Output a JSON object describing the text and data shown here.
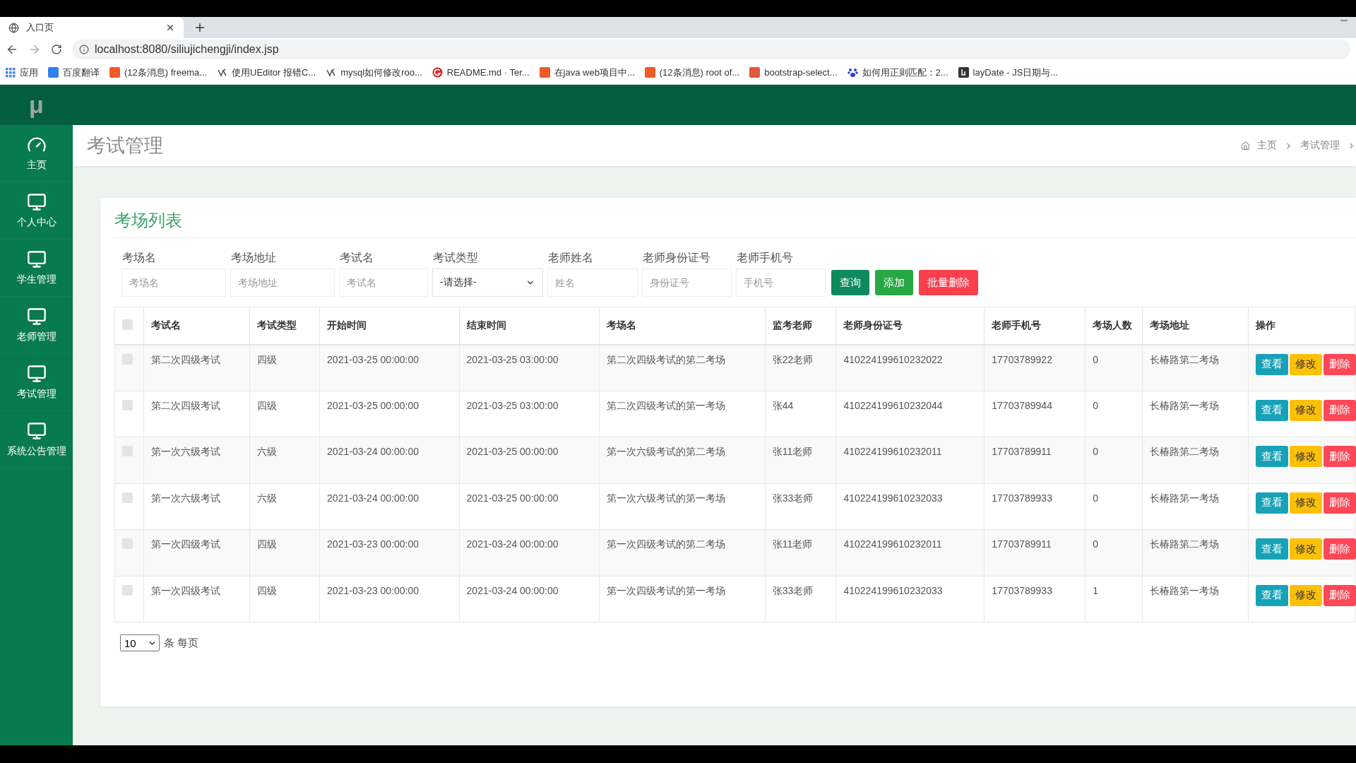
{
  "browser": {
    "tab_title": "入口页",
    "url": "localhost:8080/siliujichengji/index.jsp",
    "bookmarks": [
      {
        "label": "应用"
      },
      {
        "label": "百度翻译"
      },
      {
        "label": "(12条消息) freema..."
      },
      {
        "label": "使用UEditor 报错C..."
      },
      {
        "label": "mysql如何修改roo..."
      },
      {
        "label": "README.md · Ter..."
      },
      {
        "label": "在java web项目中..."
      },
      {
        "label": "(12条消息) root of..."
      },
      {
        "label": "bootstrap-select..."
      },
      {
        "label": "如何用正则匹配：2..."
      },
      {
        "label": "layDate - JS日期与..."
      }
    ]
  },
  "logo": "μ",
  "sidebar": {
    "items": [
      {
        "label": "主页",
        "kind": "home"
      },
      {
        "label": "个人中心",
        "kind": "page"
      },
      {
        "label": "学生管理",
        "kind": "page"
      },
      {
        "label": "老师管理",
        "kind": "page"
      },
      {
        "label": "考试管理",
        "kind": "page"
      },
      {
        "label": "系统公告管理",
        "kind": "page"
      }
    ]
  },
  "page_title": "考试管理",
  "breadcrumb": [
    "主页",
    "考试管理"
  ],
  "card_title": "考场列表",
  "filters": [
    {
      "label": "考场名",
      "kind": "input",
      "placeholder": "考场名"
    },
    {
      "label": "考场地址",
      "kind": "input",
      "placeholder": "考场地址"
    },
    {
      "label": "考试名",
      "kind": "input",
      "placeholder": "考试名"
    },
    {
      "label": "考试类型",
      "kind": "select",
      "value": "-请选择-"
    },
    {
      "label": "老师姓名",
      "kind": "input",
      "placeholder": "姓名"
    },
    {
      "label": "老师身份证号",
      "kind": "input",
      "placeholder": "身份证号"
    },
    {
      "label": "老师手机号",
      "kind": "input",
      "placeholder": "手机号"
    }
  ],
  "filter_buttons": [
    {
      "label": "查询",
      "kind": "search"
    },
    {
      "label": "添加",
      "kind": "add"
    },
    {
      "label": "批量删除",
      "kind": "delete"
    }
  ],
  "table": {
    "all_checked": false,
    "columns": [
      "考试名",
      "考试类型",
      "开始时间",
      "结束时间",
      "考场名",
      "监考老师",
      "老师身份证号",
      "老师手机号",
      "考场人数",
      "考场地址",
      "操作"
    ],
    "rows": [
      {
        "checked": false,
        "cells": [
          "第二次四级考试",
          "四级",
          "2021-03-25 00:00:00",
          "2021-03-25 03:00:00",
          "第二次四级考试的第二考场",
          "张22老师",
          "410224199610232022",
          "17703789922",
          "0",
          "长椿路第二考场"
        ],
        "actions": [
          {
            "label": "查看",
            "kind": "view"
          },
          {
            "label": "修改",
            "kind": "edit"
          },
          {
            "label": "删除",
            "kind": "delete"
          }
        ]
      },
      {
        "checked": false,
        "cells": [
          "第二次四级考试",
          "四级",
          "2021-03-25 00:00:00",
          "2021-03-25 03:00:00",
          "第二次四级考试的第一考场",
          "张44",
          "410224199610232044",
          "17703789944",
          "0",
          "长椿路第一考场"
        ],
        "actions": [
          {
            "label": "查看",
            "kind": "view"
          },
          {
            "label": "修改",
            "kind": "edit"
          },
          {
            "label": "删除",
            "kind": "delete"
          }
        ]
      },
      {
        "checked": false,
        "cells": [
          "第一次六级考试",
          "六级",
          "2021-03-24 00:00:00",
          "2021-03-25 00:00:00",
          "第一次六级考试的第二考场",
          "张11老师",
          "410224199610232011",
          "17703789911",
          "0",
          "长椿路第二考场"
        ],
        "actions": [
          {
            "label": "查看",
            "kind": "view"
          },
          {
            "label": "修改",
            "kind": "edit"
          },
          {
            "label": "删除",
            "kind": "delete"
          }
        ]
      },
      {
        "checked": false,
        "cells": [
          "第一次六级考试",
          "六级",
          "2021-03-24 00:00:00",
          "2021-03-25 00:00:00",
          "第一次六级考试的第一考场",
          "张33老师",
          "410224199610232033",
          "17703789933",
          "0",
          "长椿路第一考场"
        ],
        "actions": [
          {
            "label": "查看",
            "kind": "view"
          },
          {
            "label": "修改",
            "kind": "edit"
          },
          {
            "label": "删除",
            "kind": "delete"
          }
        ]
      },
      {
        "checked": false,
        "cells": [
          "第一次四级考试",
          "四级",
          "2021-03-23 00:00:00",
          "2021-03-24 00:00:00",
          "第一次四级考试的第二考场",
          "张11老师",
          "410224199610232011",
          "17703789911",
          "0",
          "长椿路第二考场"
        ],
        "actions": [
          {
            "label": "查看",
            "kind": "view"
          },
          {
            "label": "修改",
            "kind": "edit"
          },
          {
            "label": "删除",
            "kind": "delete"
          }
        ]
      },
      {
        "checked": false,
        "cells": [
          "第一次四级考试",
          "四级",
          "2021-03-23 00:00:00",
          "2021-03-24 00:00:00",
          "第一次四级考试的第一考场",
          "张33老师",
          "410224199610232033",
          "17703789933",
          "1",
          "长椿路第一考场"
        ],
        "actions": [
          {
            "label": "查看",
            "kind": "view"
          },
          {
            "label": "修改",
            "kind": "edit"
          },
          {
            "label": "删除",
            "kind": "delete"
          }
        ]
      }
    ]
  },
  "pagination": {
    "page_size": "10",
    "label": "条 每页"
  }
}
